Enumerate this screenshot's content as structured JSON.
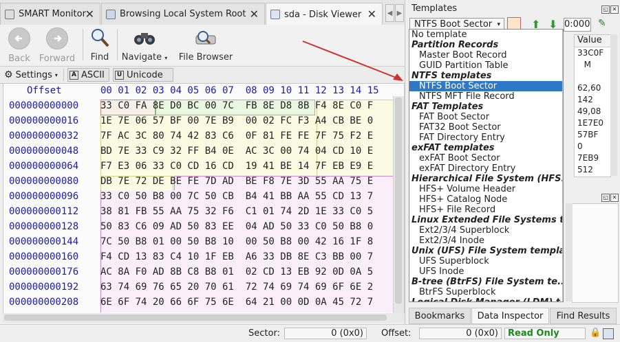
{
  "tabs": [
    {
      "label": "SMART Monitor",
      "active": false
    },
    {
      "label": "Browsing Local System Root",
      "active": false
    },
    {
      "label": "sda - Disk Viewer",
      "active": true
    }
  ],
  "toolbar": {
    "back": "Back",
    "forward": "Forward",
    "find": "Find",
    "navigate": "Navigate",
    "file_browser": "File Browser"
  },
  "settings": {
    "settings": "Settings",
    "ascii": "ASCII",
    "unicode": "Unicode",
    "ascii_box": "A",
    "unicode_box": "U"
  },
  "hex": {
    "offset_header": "Offset",
    "column_header": "00 01 02 03 04 05 06 07  08 09 10 11 12 13 14 15",
    "rows": [
      {
        "offset": "000000000000",
        "bytes": "33 C0 FA 8E D0 BC 00 7C  FB 8E D8 8B F4 8E C0 F"
      },
      {
        "offset": "000000000016",
        "bytes": "1E 7E 06 57 BF 00 7E B9  00 02 FC F3 A4 CB BE 0"
      },
      {
        "offset": "000000000032",
        "bytes": "7F AC 3C 80 74 42 83 C6  0F 81 FE FE 7F 75 F2 E"
      },
      {
        "offset": "000000000048",
        "bytes": "BD 7E 33 C9 32 FF B4 0E  AC 3C 00 74 04 CD 10 E"
      },
      {
        "offset": "000000000064",
        "bytes": "F7 E3 06 33 C0 CD 16 CD  19 41 BE 14 7F EB E9 E"
      },
      {
        "offset": "000000000080",
        "bytes": "DB 7E 72 DE BE FE 7D AD  BE F8 7E 3D 55 AA 75 E"
      },
      {
        "offset": "000000000096",
        "bytes": "33 C0 50 B8 00 7C 50 CB  B4 41 BB AA 55 CD 13 7"
      },
      {
        "offset": "000000000112",
        "bytes": "38 81 FB 55 AA 75 32 F6  C1 01 74 2D 1E 33 C0 5"
      },
      {
        "offset": "000000000128",
        "bytes": "50 83 C6 09 AD 50 83 EE  04 AD 50 33 C0 50 B8 0"
      },
      {
        "offset": "000000000144",
        "bytes": "7C 50 B8 01 00 50 B8 10  00 50 B8 00 42 16 1F 8"
      },
      {
        "offset": "000000000160",
        "bytes": "F4 CD 13 83 C4 10 1F EB  A6 33 DB 8E C3 BB 00 7"
      },
      {
        "offset": "000000000176",
        "bytes": "AC 8A F0 AD 8B C8 B8 01  02 CD 13 EB 92 0D 0A 5"
      },
      {
        "offset": "000000000192",
        "bytes": "63 74 69 76 65 20 70 61  72 74 69 74 69 6F 6E 2"
      },
      {
        "offset": "000000000208",
        "bytes": "6E 6F 74 20 66 6F 75 6E  64 21 00 0D 0A 45 72 7"
      }
    ]
  },
  "templates": {
    "title": "Templates",
    "selected": "NTFS Boot Sector",
    "offset_value": "0:000",
    "dropdown": [
      {
        "kind": "n",
        "label": "No template"
      },
      {
        "kind": "h",
        "label": "Partition Records"
      },
      {
        "kind": "i",
        "label": "Master Boot Record"
      },
      {
        "kind": "i",
        "label": "GUID Partition Table"
      },
      {
        "kind": "h",
        "label": "NTFS templates"
      },
      {
        "kind": "i",
        "label": "NTFS Boot Sector",
        "selected": true
      },
      {
        "kind": "i",
        "label": "NTFS MFT File Record"
      },
      {
        "kind": "h",
        "label": "FAT Templates"
      },
      {
        "kind": "i",
        "label": "FAT Boot Sector"
      },
      {
        "kind": "i",
        "label": "FAT32 Boot Sector"
      },
      {
        "kind": "i",
        "label": "FAT Directory Entry"
      },
      {
        "kind": "h",
        "label": "exFAT templates"
      },
      {
        "kind": "i",
        "label": "exFAT Boot Sector"
      },
      {
        "kind": "i",
        "label": "exFAT Directory Entry"
      },
      {
        "kind": "h",
        "label": "Hierarchical File System (HFS..."
      },
      {
        "kind": "i",
        "label": "HFS+ Volume Header"
      },
      {
        "kind": "i",
        "label": "HFS+ Catalog Node"
      },
      {
        "kind": "i",
        "label": "HFS+ File Record"
      },
      {
        "kind": "h",
        "label": "Linux Extended File Systems t..."
      },
      {
        "kind": "i",
        "label": "Ext2/3/4 Superblock"
      },
      {
        "kind": "i",
        "label": "Ext2/3/4 Inode"
      },
      {
        "kind": "h",
        "label": "Unix (UFS) File System templa..."
      },
      {
        "kind": "i",
        "label": "UFS Superblock"
      },
      {
        "kind": "i",
        "label": "UFS Inode"
      },
      {
        "kind": "h",
        "label": "B-tree (BtrFS) File System te..."
      },
      {
        "kind": "i",
        "label": "BtrFS Superblock"
      },
      {
        "kind": "h",
        "label": "Logical Disk Manager (LDM) t..."
      }
    ],
    "value_header": "Value",
    "values": [
      "33C0F",
      "M",
      "",
      "62,60",
      "142",
      "49,08",
      "1E7E0",
      "57BF",
      "0",
      "7EB9",
      "512"
    ]
  },
  "bottom_tabs": [
    "Bookmarks",
    "Data Inspector",
    "Find Results"
  ],
  "status": {
    "sector_label": "Sector:",
    "sector_value": "0 (0x0)",
    "offset_label": "Offset:",
    "offset_value": "0 (0x0)",
    "mode": "Read Only"
  },
  "colors": {
    "accent": "#2f78c6",
    "selection_red": "#cf3a3a",
    "tpl_green": "#eef8e6",
    "tpl_yellow": "#fbfbe6",
    "tpl_pink": "#fbeefb",
    "read_only": "#1a8a1a"
  }
}
